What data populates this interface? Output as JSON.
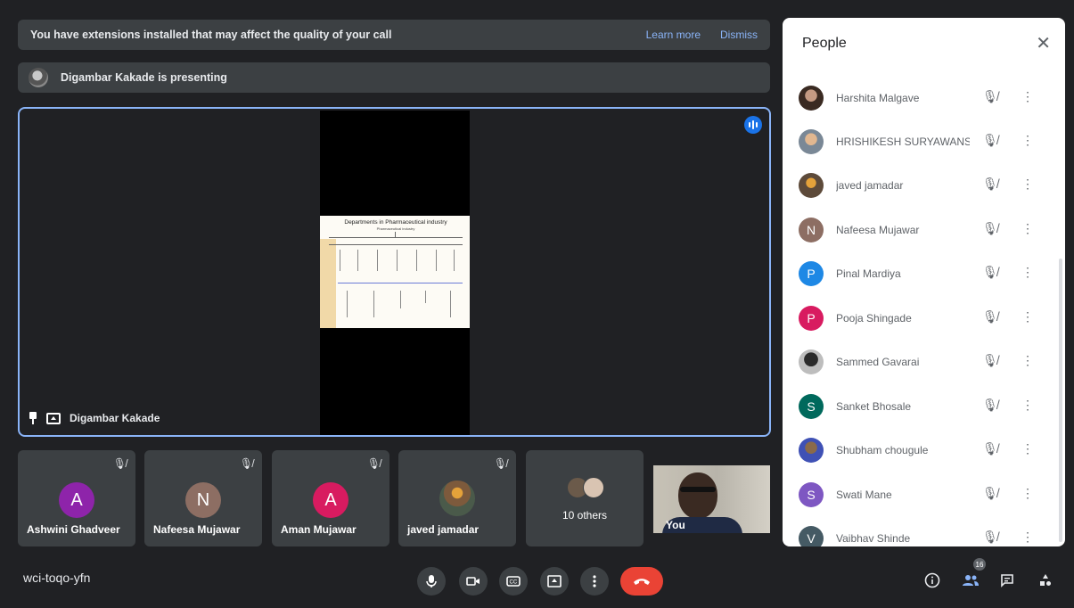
{
  "banner": {
    "message": "You have extensions installed that may affect the quality of your call",
    "learn_more": "Learn more",
    "dismiss": "Dismiss"
  },
  "presenting": {
    "text": "Digambar Kakade is presenting"
  },
  "stage": {
    "presenter_name": "Digambar Kakade",
    "slide_title": "Departments in Pharmaceutical industry",
    "slide_subtitle": "Pharmaceutical industry"
  },
  "tiles": [
    {
      "name": "Ashwini Ghadveer",
      "initial": "A",
      "color": "#8e24aa"
    },
    {
      "name": "Nafeesa Mujawar",
      "initial": "N",
      "color": "#8d6e63"
    },
    {
      "name": "Aman Mujawar",
      "initial": "A",
      "color": "#d81b60"
    },
    {
      "name": "javed jamadar",
      "initial": "",
      "color": ""
    }
  ],
  "others": {
    "label": "10 others"
  },
  "selfview": {
    "label": "You"
  },
  "bottom": {
    "meeting_code": "wci-toqo-yfn",
    "participant_count": "16"
  },
  "icons": {
    "mute": "mic-off-icon",
    "more": "more-vert-icon"
  },
  "panel": {
    "title": "People",
    "people": [
      {
        "name": "Harshita Malgave",
        "initial": "",
        "color": "#6d4c41",
        "photo": true
      },
      {
        "name": "HRISHIKESH SURYAWANS...",
        "initial": "",
        "color": "#9c7a54",
        "photo": true
      },
      {
        "name": "javed jamadar",
        "initial": "",
        "color": "#5d4a3a",
        "photo": true
      },
      {
        "name": "Nafeesa Mujawar",
        "initial": "N",
        "color": "#8d6e63",
        "photo": false
      },
      {
        "name": "Pinal Mardiya",
        "initial": "P",
        "color": "#1e88e5",
        "photo": false
      },
      {
        "name": "Pooja Shingade",
        "initial": "P",
        "color": "#d81b60",
        "photo": false
      },
      {
        "name": "Sammed Gavarai",
        "initial": "",
        "color": "#555555",
        "photo": true
      },
      {
        "name": "Sanket Bhosale",
        "initial": "S",
        "color": "#00695c",
        "photo": false
      },
      {
        "name": "Shubham chougule",
        "initial": "",
        "color": "#5c6bc0",
        "photo": true
      },
      {
        "name": "Swati Mane",
        "initial": "S",
        "color": "#7e57c2",
        "photo": false
      },
      {
        "name": "Vaibhav Shinde",
        "initial": "V",
        "color": "#455a64",
        "photo": false
      }
    ]
  }
}
